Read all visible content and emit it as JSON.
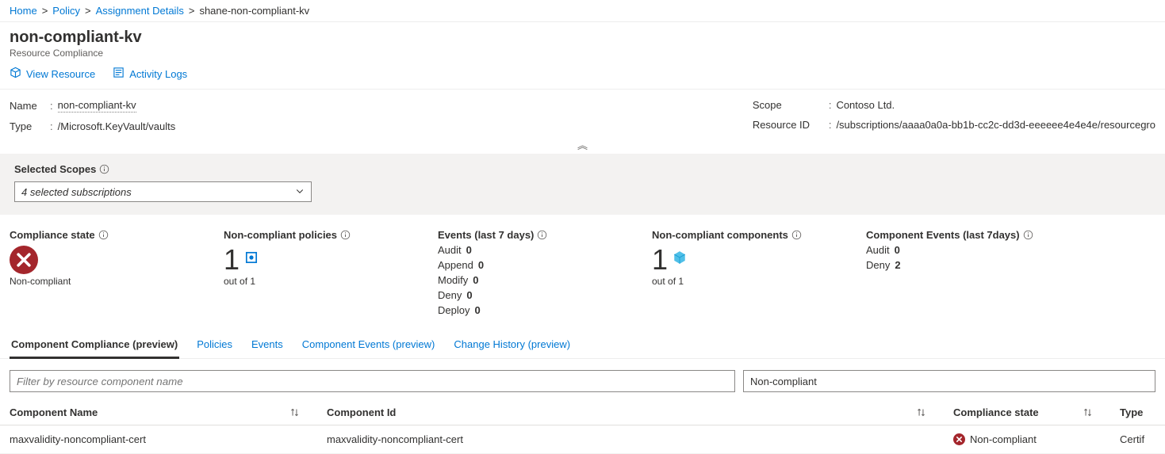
{
  "breadcrumb": {
    "home": "Home",
    "policy": "Policy",
    "assignment": "Assignment Details",
    "current": "shane-non-compliant-kv"
  },
  "header": {
    "title": "non-compliant-kv",
    "subtitle": "Resource Compliance"
  },
  "toolbar": {
    "view_resource": "View Resource",
    "activity_logs": "Activity Logs"
  },
  "props": {
    "name_label": "Name",
    "name_value": "non-compliant-kv",
    "type_label": "Type",
    "type_value": "/Microsoft.KeyVault/vaults",
    "scope_label": "Scope",
    "scope_value": "Contoso Ltd.",
    "resid_label": "Resource ID",
    "resid_value": "/subscriptions/aaaa0a0a-bb1b-cc2c-dd3d-eeeeee4e4e4e/resourcegro"
  },
  "scopes": {
    "label": "Selected Scopes",
    "dropdown_text": "4 selected subscriptions"
  },
  "stats": {
    "compliance_state": {
      "title": "Compliance state",
      "value": "Non-compliant"
    },
    "nc_policies": {
      "title": "Non-compliant policies",
      "num": "1",
      "sub": "out of 1"
    },
    "events": {
      "title": "Events (last 7 days)",
      "items": [
        {
          "label": "Audit",
          "value": "0"
        },
        {
          "label": "Append",
          "value": "0"
        },
        {
          "label": "Modify",
          "value": "0"
        },
        {
          "label": "Deny",
          "value": "0"
        },
        {
          "label": "Deploy",
          "value": "0"
        }
      ]
    },
    "nc_components": {
      "title": "Non-compliant components",
      "num": "1",
      "sub": "out of 1"
    },
    "comp_events": {
      "title": "Component Events (last 7days)",
      "items": [
        {
          "label": "Audit",
          "value": "0"
        },
        {
          "label": "Deny",
          "value": "2"
        }
      ]
    }
  },
  "tabs": {
    "t0": "Component Compliance (preview)",
    "t1": "Policies",
    "t2": "Events",
    "t3": "Component Events (preview)",
    "t4": "Change History (preview)"
  },
  "filter": {
    "placeholder": "Filter by resource component name",
    "state_filter": "Non-compliant"
  },
  "table": {
    "cols": {
      "name": "Component Name",
      "id": "Component Id",
      "state": "Compliance state",
      "type": "Type"
    },
    "rows": [
      {
        "name": "maxvalidity-noncompliant-cert",
        "id": "maxvalidity-noncompliant-cert",
        "state": "Non-compliant",
        "type": "Certif"
      }
    ]
  }
}
